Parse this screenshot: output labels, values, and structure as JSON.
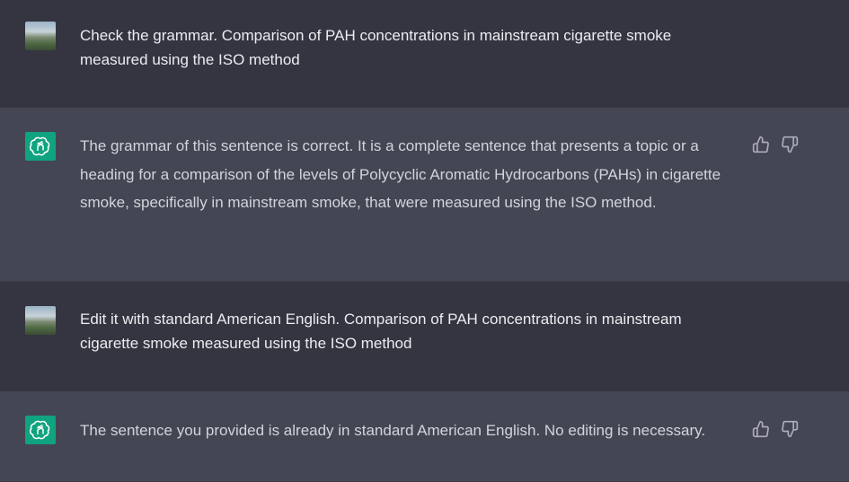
{
  "conversation": {
    "messages": [
      {
        "role": "user",
        "text": "Check the grammar. Comparison of PAH concentrations in mainstream cigarette smoke measured using the ISO method",
        "avatar_icon": "user-avatar-photo"
      },
      {
        "role": "assistant",
        "text": "The grammar of this sentence is correct. It is a complete sentence that presents a topic or a heading for a comparison of the levels of Polycyclic Aromatic Hydrocarbons (PAHs) in cigarette smoke, specifically in mainstream smoke, that were measured using the ISO method.",
        "avatar_icon": "openai-logo-icon"
      },
      {
        "role": "user",
        "text": "Edit it with standard American English. Comparison of PAH concentrations in mainstream cigarette smoke measured using the ISO method",
        "avatar_icon": "user-avatar-photo"
      },
      {
        "role": "assistant",
        "text": "The sentence you provided is already in standard American English. No editing is necessary.",
        "avatar_icon": "openai-logo-icon"
      }
    ]
  },
  "feedback_icons": [
    "thumbs-up-icon",
    "thumbs-down-icon"
  ],
  "colors": {
    "user_bg": "#343541",
    "assistant_bg": "#444654",
    "avatar_bot": "#10a37f",
    "text": "#ececf1"
  }
}
